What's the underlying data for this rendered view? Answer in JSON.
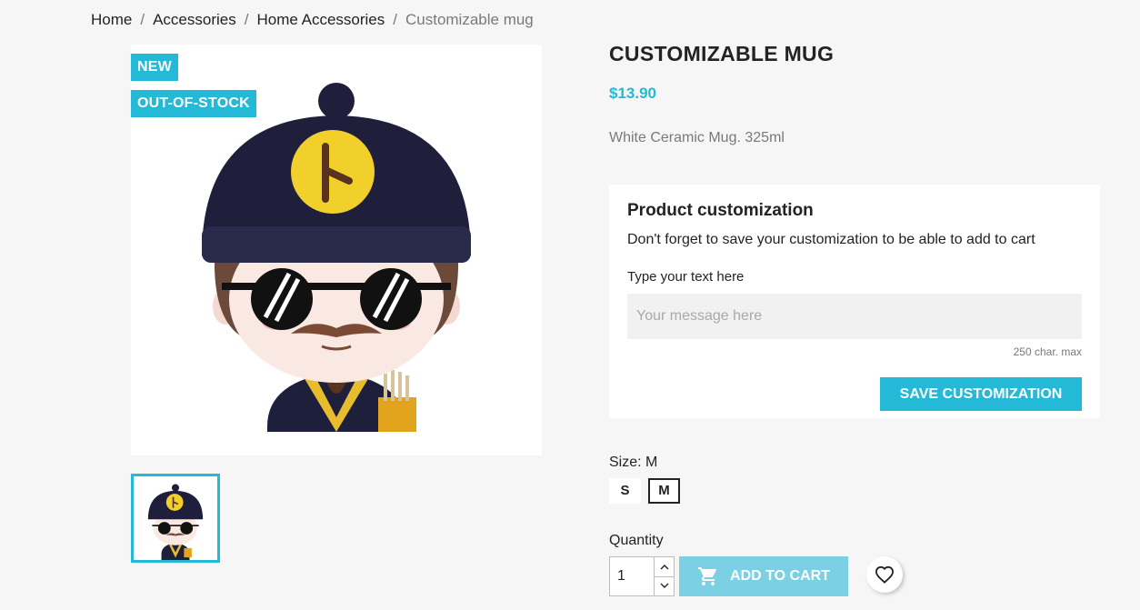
{
  "breadcrumb": {
    "items": [
      "Home",
      "Accessories",
      "Home Accessories"
    ],
    "current": "Customizable mug",
    "separator": "/"
  },
  "product": {
    "flags": {
      "new": "NEW",
      "out_of_stock": "OUT-OF-STOCK"
    },
    "title": "CUSTOMIZABLE MUG",
    "price": "$13.90",
    "description": "White Ceramic Mug. 325ml"
  },
  "customization": {
    "heading": "Product customization",
    "note": "Don't forget to save your customization to be able to add to cart",
    "field_label": "Type your text here",
    "placeholder": "Your message here",
    "max_note": "250 char. max",
    "save_label": "SAVE CUSTOMIZATION"
  },
  "size": {
    "label": "Size: M",
    "options": [
      "S",
      "M"
    ],
    "selected": "M"
  },
  "quantity": {
    "label": "Quantity",
    "value": "1"
  },
  "cart": {
    "add_label": "ADD TO CART"
  },
  "colors": {
    "accent": "#24b9d7",
    "cart_disabled": "#7bd0e3",
    "background": "#f6f6f6"
  }
}
